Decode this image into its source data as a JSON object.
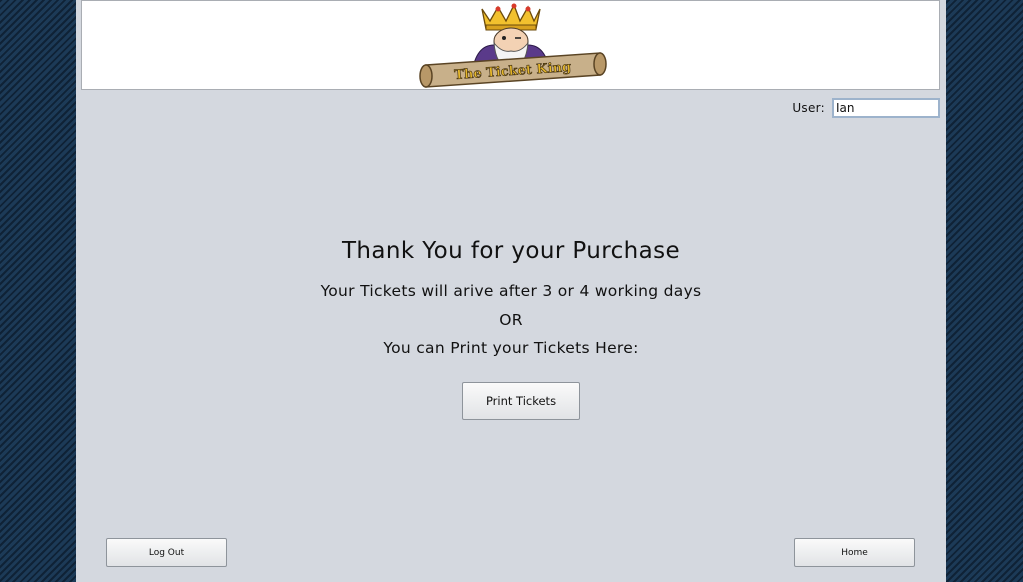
{
  "header": {
    "logo_text": "The Ticket King"
  },
  "user": {
    "label": "User:",
    "value": "Ian"
  },
  "confirmation": {
    "title": "Thank You for your Purchase",
    "line1": "Your Tickets will arive after 3 or 4 working days",
    "line2": "OR",
    "line3": "You can Print your Tickets Here:"
  },
  "buttons": {
    "print_label": "Print Tickets",
    "logout_label": "Log Out",
    "home_label": "Home"
  },
  "colors": {
    "background": "#163049",
    "panel": "#d4d8df",
    "banner": "#ffffff",
    "crown": "#f2c12e",
    "scroll": "#c8b08a"
  }
}
